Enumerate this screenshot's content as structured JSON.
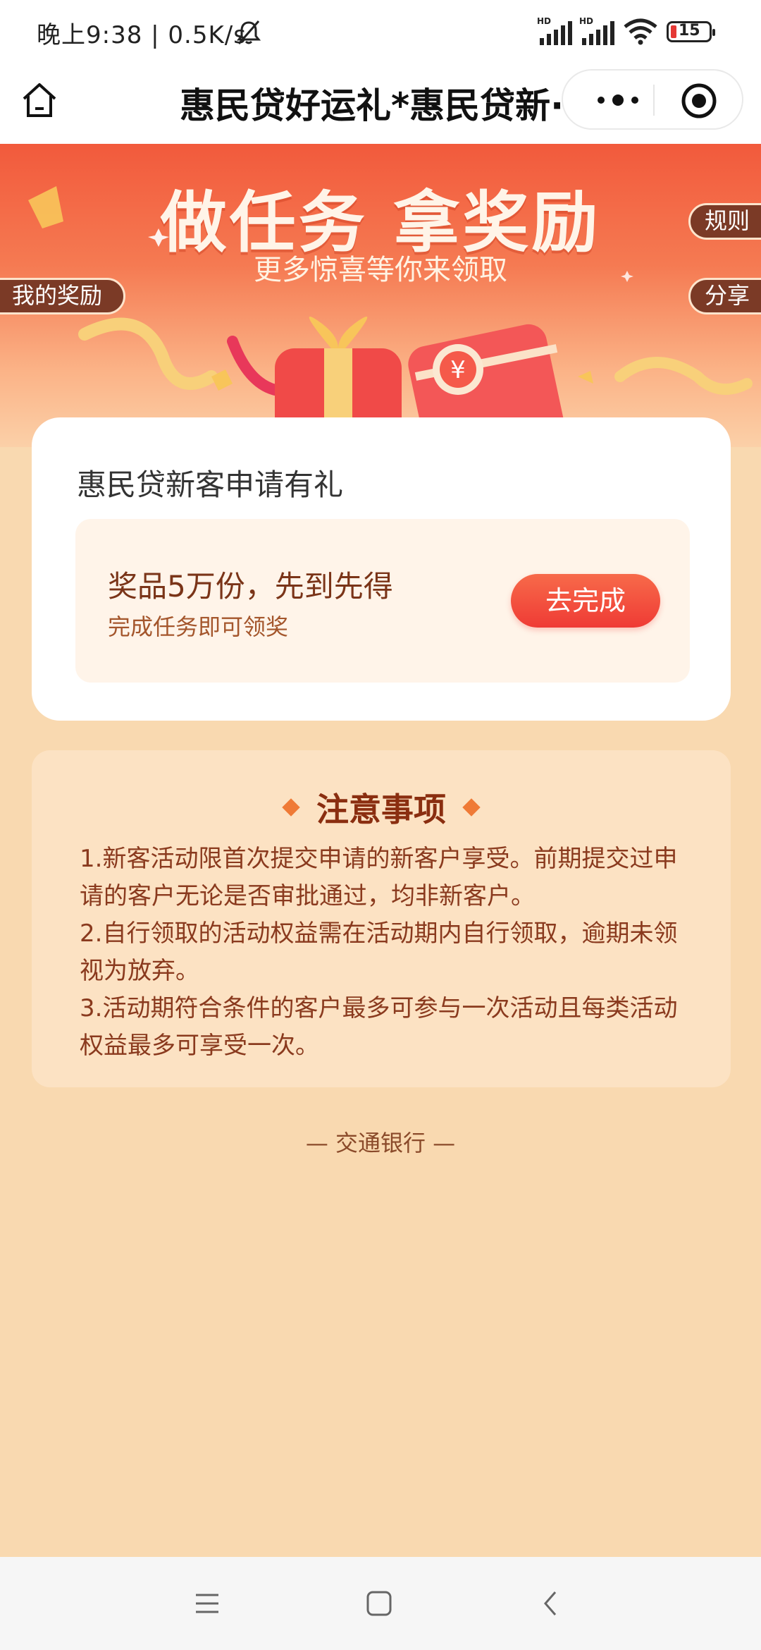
{
  "status_bar": {
    "time": "晚上9:38 | 0.5K/s",
    "battery_level": "15",
    "icons": [
      "bell-off-icon",
      "hd-signal-icon",
      "hd-signal-icon",
      "wifi-icon",
      "battery-icon"
    ]
  },
  "nav_bar": {
    "title": "惠民贷好运礼*惠民贷新···",
    "home_icon": "home-icon",
    "more_icon": "more-dots-icon",
    "close_icon": "target-close-icon"
  },
  "banner": {
    "title": "做任务 拿奖励",
    "subtitle": "更多惊喜等你来领取",
    "rules_label": "规则",
    "share_label": "分享",
    "my_rewards_label": "我的奖励"
  },
  "task_card": {
    "title": "惠民贷新客申请有礼",
    "item_title": "奖品5万份，先到先得",
    "item_desc": "完成任务即可领奖",
    "button_label": "去完成"
  },
  "notes": {
    "title": "注意事项",
    "items": [
      "1.新客活动限首次提交申请的新客户享受。前期提交过申请的客户无论是否审批通过，均非新客户。",
      "2.自行领取的活动权益需在活动期内自行领取，逾期未领视为放弃。",
      "3.活动期符合条件的客户最多可参与一次活动且每类活动权益最多可享受一次。"
    ]
  },
  "footer": "— 交通银行 —",
  "colors": {
    "page_bg": "#f9d9b0",
    "accent_red": "#ef3b35",
    "pill_brown": "#7b3a26",
    "notes_title": "#8a2e10"
  }
}
